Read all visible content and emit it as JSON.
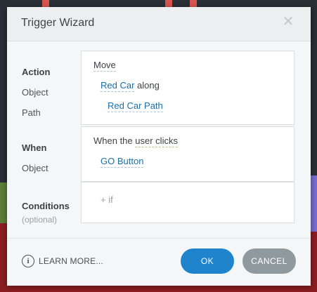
{
  "dialog": {
    "title": "Trigger Wizard",
    "close_icon": "close-icon"
  },
  "action": {
    "label": "Action",
    "object_label": "Object",
    "path_label": "Path",
    "verb": "Move",
    "object_value": "Red Car",
    "connector": "along",
    "path_value": "Red Car Path"
  },
  "when": {
    "label": "When",
    "object_label": "Object",
    "prefix": "When the",
    "event": "user clicks",
    "object_value": "GO Button"
  },
  "conditions": {
    "label": "Conditions",
    "sublabel": "(optional)",
    "add_if": "+ if"
  },
  "footer": {
    "learn_more": "LEARN MORE...",
    "info_icon": "info-icon",
    "ok": "OK",
    "cancel": "CANCEL"
  },
  "colors": {
    "accent": "#1f84cc",
    "link": "#1b6fa8",
    "cancel": "#8f9a9f"
  }
}
